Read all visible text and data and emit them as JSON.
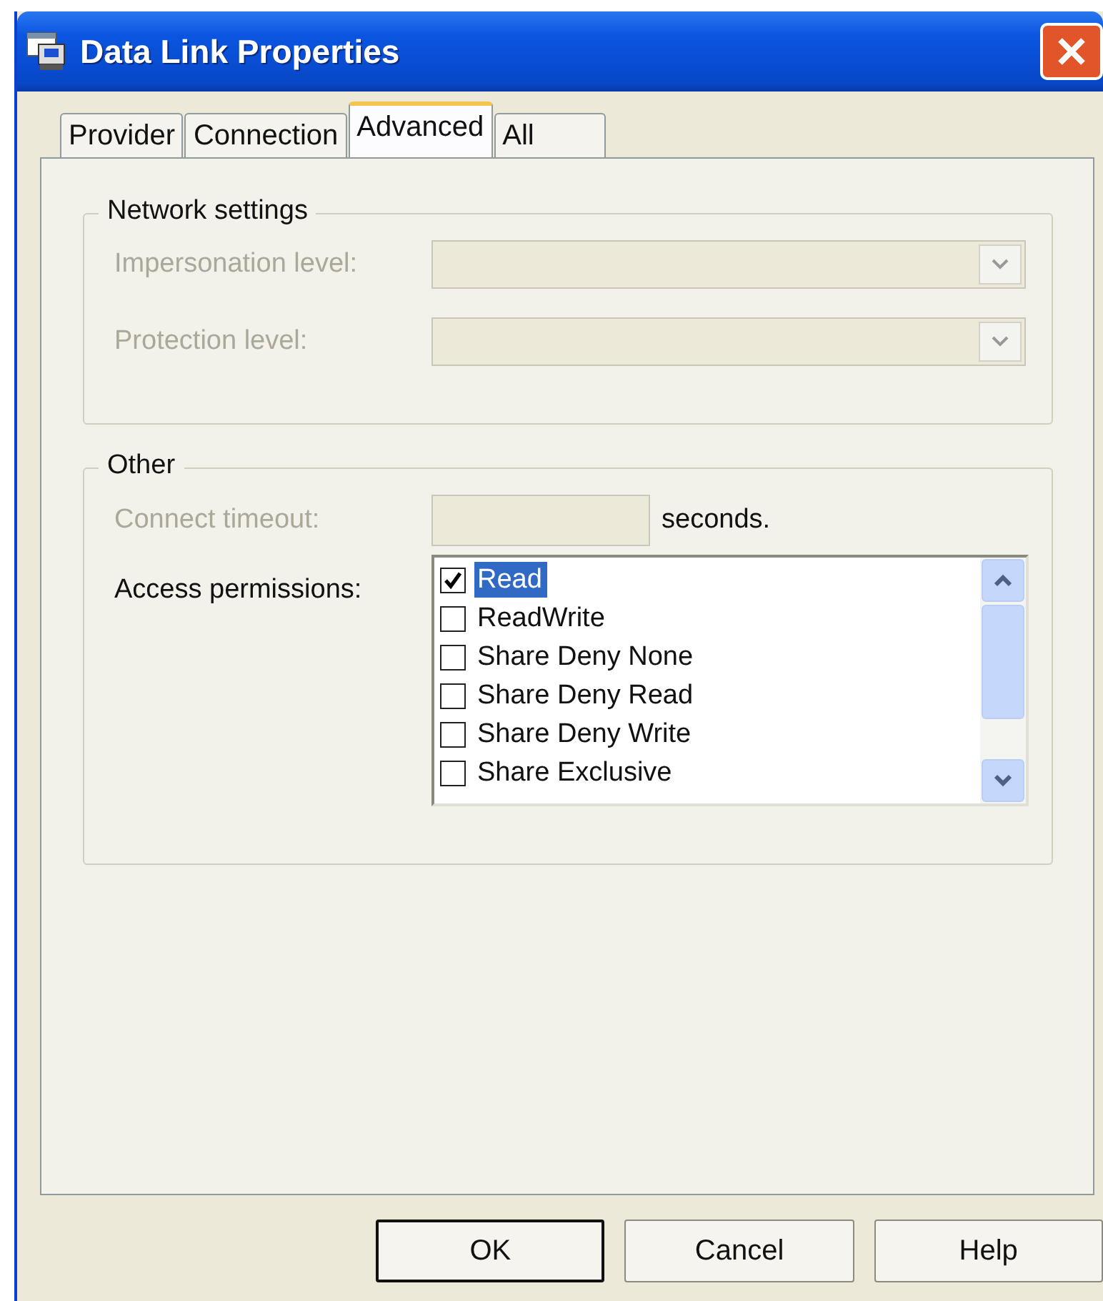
{
  "window": {
    "title": "Data Link Properties"
  },
  "tabs": [
    {
      "label": "Provider",
      "selected": false
    },
    {
      "label": "Connection",
      "selected": false
    },
    {
      "label": "Advanced",
      "selected": true
    },
    {
      "label": "All",
      "selected": false
    }
  ],
  "network_settings": {
    "title": "Network settings",
    "fields": [
      {
        "label": "Impersonation level:",
        "disabled": true
      },
      {
        "label": "Protection level:",
        "disabled": true
      }
    ]
  },
  "other": {
    "title": "Other",
    "connect_timeout": {
      "label": "Connect timeout:",
      "disabled": true,
      "unit": "seconds."
    },
    "access_permissions": {
      "label": "Access permissions:",
      "items": [
        {
          "label": "Read",
          "checked": true,
          "selected": true
        },
        {
          "label": "ReadWrite",
          "checked": false,
          "selected": false
        },
        {
          "label": "Share Deny None",
          "checked": false,
          "selected": false
        },
        {
          "label": "Share Deny Read",
          "checked": false,
          "selected": false
        },
        {
          "label": "Share Deny Write",
          "checked": false,
          "selected": false
        },
        {
          "label": "Share Exclusive",
          "checked": false,
          "selected": false
        }
      ]
    }
  },
  "buttons": [
    {
      "label": "OK",
      "default": true
    },
    {
      "label": "Cancel",
      "default": false
    },
    {
      "label": "Help",
      "default": false
    }
  ]
}
